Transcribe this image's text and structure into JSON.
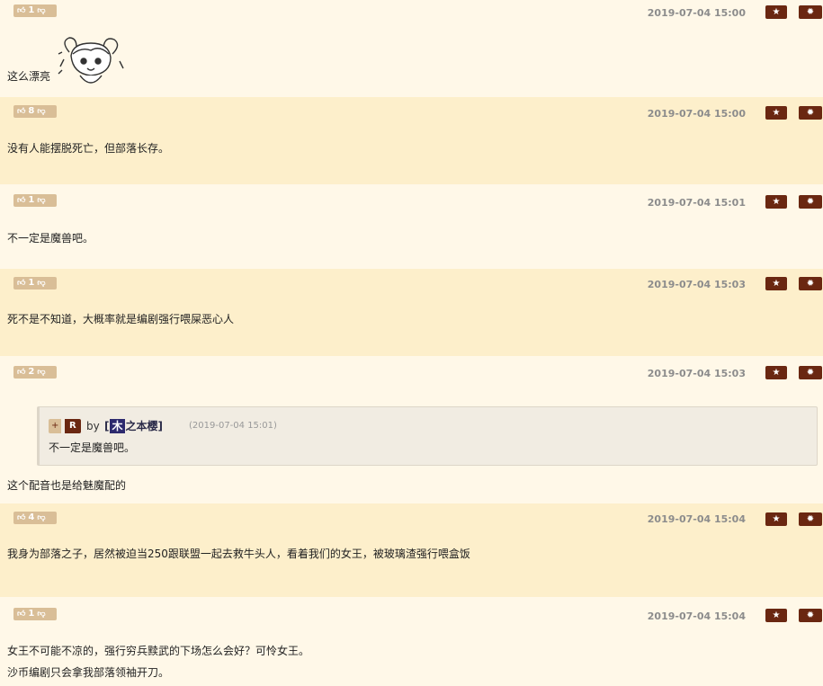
{
  "accent": "#6a2711",
  "vote_color": "#d9be97",
  "star_icon": "star-icon",
  "gear_icon": "gear-icon",
  "posts": [
    {
      "votes": "1",
      "time": "2019-07-04 15:00",
      "lines": [
        "这么漂亮"
      ]
    },
    {
      "votes": "8",
      "time": "2019-07-04 15:00",
      "lines": [
        "没有人能摆脱死亡，但部落长存。"
      ]
    },
    {
      "votes": "1",
      "time": "2019-07-04 15:01",
      "lines": [
        "不一定是魔兽吧。"
      ]
    },
    {
      "votes": "1",
      "time": "2019-07-04 15:03",
      "lines": [
        "死不是不知道，大概率就是编剧强行喂屎恶心人"
      ]
    },
    {
      "votes": "2",
      "time": "2019-07-04 15:03",
      "lines": [
        "这个配音也是给魅魔配的"
      ],
      "quote": {
        "plus": "+",
        "r": "R",
        "by": "by",
        "user_open": "[",
        "user_block": "木",
        "user_rest": "之本樱",
        "user_close": "]",
        "time": "(2019-07-04 15:01)",
        "text": "不一定是魔兽吧。"
      }
    },
    {
      "votes": "4",
      "time": "2019-07-04 15:04",
      "lines": [
        "我身为部落之子，居然被迫当250跟联盟一起去救牛头人，看着我们的女王，被玻璃渣强行喂盒饭"
      ]
    },
    {
      "votes": "1",
      "time": "2019-07-04 15:04",
      "lines": [
        "女王不可能不凉的，强行穷兵黩武的下场怎么会好？可怜女王。",
        "沙币编剧只会拿我部落领袖开刀。"
      ]
    }
  ]
}
